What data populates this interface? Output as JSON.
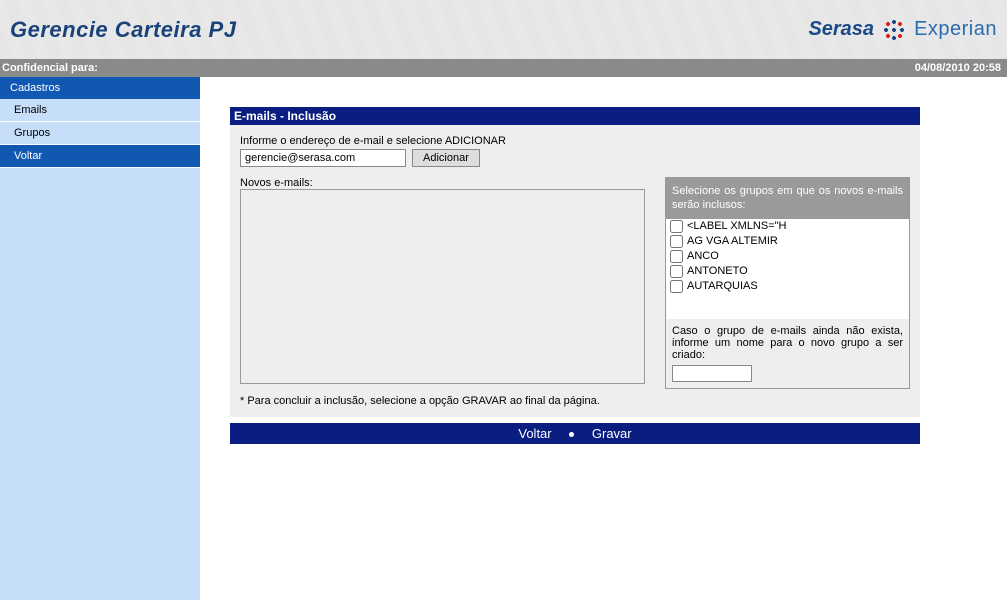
{
  "header": {
    "title": "Gerencie Carteira PJ",
    "brand_left": "Serasa",
    "brand_right": "Experian"
  },
  "status": {
    "left": "Confidencial para:",
    "right": "04/08/2010 20:58"
  },
  "sidebar": {
    "group": "Cadastros",
    "items": [
      {
        "label": "Emails"
      },
      {
        "label": "Grupos"
      },
      {
        "label": "Voltar",
        "active": true
      }
    ]
  },
  "panel": {
    "title": "E-mails - Inclusão",
    "instruction": "Informe o endereço de e-mail e selecione ADICIONAR",
    "email_value": "gerencie@serasa.com",
    "add_button": "Adicionar",
    "new_emails_label": "Novos e-mails:",
    "new_emails_value": "",
    "groups_instruction": "Selecione os grupos em que os novos e-mails serão inclusos:",
    "groups": [
      "<LABEL XMLNS=\"H",
      "AG VGA ALTEMIR",
      "ANCO",
      "ANTONETO",
      "AUTARQUIAS"
    ],
    "new_group_hint": "Caso o grupo de e-mails ainda não exista, informe um nome para o novo grupo a ser criado:",
    "new_group_value": "",
    "note": "* Para concluir a inclusão, selecione a opção GRAVAR ao final da página."
  },
  "actions": {
    "voltar": "Voltar",
    "gravar": "Gravar"
  }
}
